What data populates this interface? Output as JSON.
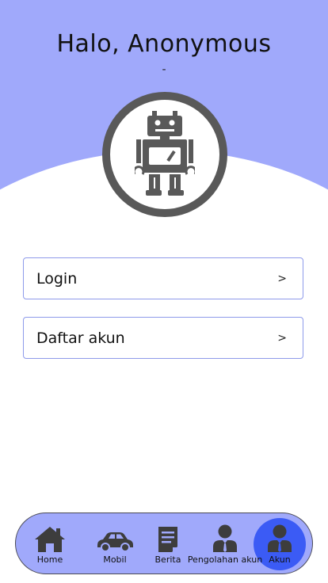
{
  "header": {
    "greeting": "Halo, Anonymous",
    "subtitle": "-",
    "avatar_icon": "robot-icon",
    "background_color": "#a0a9fb"
  },
  "menu": [
    {
      "label": "Login",
      "chevron": ">"
    },
    {
      "label": "Daftar akun",
      "chevron": ">"
    }
  ],
  "bottom_nav": {
    "active_index": 4,
    "active_color": "#3b5bf5",
    "items": [
      {
        "label": "Home",
        "icon": "home-icon"
      },
      {
        "label": "Mobil",
        "icon": "car-icon"
      },
      {
        "label": "Berita",
        "icon": "news-icon"
      },
      {
        "label": "Pengolahan akun",
        "icon": "user-manage-icon"
      },
      {
        "label": "Akun",
        "icon": "account-icon"
      }
    ]
  }
}
